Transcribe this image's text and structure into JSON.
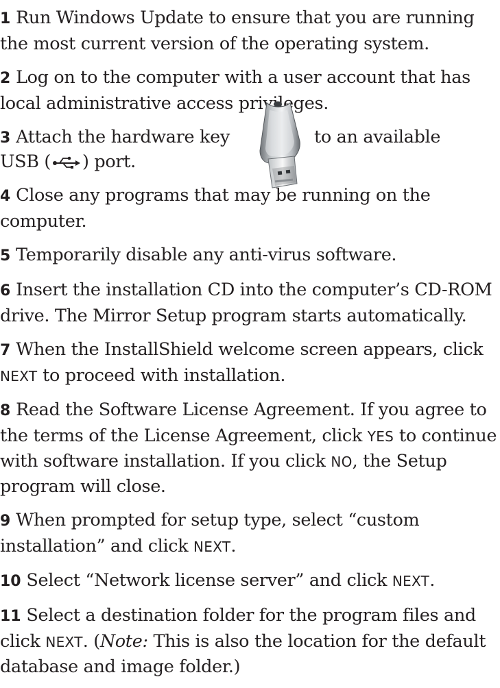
{
  "steps": [
    {
      "num": "1",
      "text": "Run Windows Update to ensure that you are running the most current version of the operating system."
    },
    {
      "num": "2",
      "text": "Log on to the computer with a user account that has local administrative access privileges."
    },
    {
      "num": "3",
      "text_a": "Attach the hardware key",
      "text_b": "to an available",
      "text_c": "USB (",
      "text_d": ") port."
    },
    {
      "num": "4",
      "text": "Close any programs that may be running on the computer."
    },
    {
      "num": "5",
      "text": "Temporarily disable any anti-virus software."
    },
    {
      "num": "6",
      "text": "Insert the installation CD into the computer’s CD-ROM drive. The Mirror Setup program starts automatically."
    },
    {
      "num": "7",
      "text_a": "When the InstallShield welcome screen appears, click",
      "kw1": "NEXT",
      "text_b": "to proceed with installation."
    },
    {
      "num": "8",
      "text_a": "Read the Software License Agreement. If you agree to the terms of the License Agreement, click",
      "kw1": "YES",
      "text_b": "to continue with software installation. If you click",
      "kw2": "NO",
      "text_c": ", the Setup program will close."
    },
    {
      "num": "9",
      "text_a": "When prompted for setup type, select “custom installation” and click",
      "kw1": "NEXT",
      "text_b": "."
    },
    {
      "num": "10",
      "text_a": "Select “Network license server” and click",
      "kw1": "NEXT",
      "text_b": "."
    },
    {
      "num": "11",
      "text_a": "Select a destination folder for the program files and click",
      "kw1": "NEXT",
      "text_b": ". (",
      "note": "Note:",
      "text_c": " This is also the location for the default database and image folder.)"
    }
  ],
  "icons": {
    "hardware_key": "usb-hardware-key-icon",
    "usb_symbol": "usb-symbol-icon"
  },
  "colors": {
    "text": "#231f20",
    "background": "#ffffff"
  }
}
